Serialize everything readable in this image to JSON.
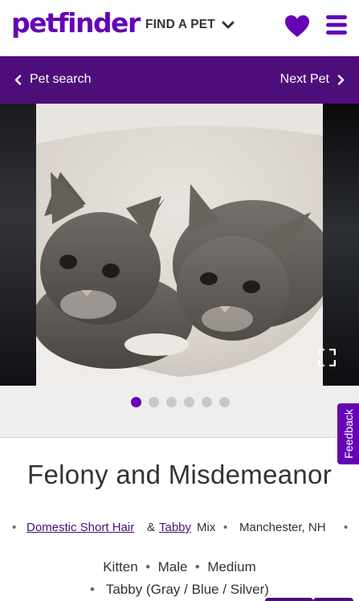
{
  "header": {
    "logo": "petfinder",
    "find_pet": "FIND A PET",
    "brand_color": "#6504b5"
  },
  "nav": {
    "prev_label": "Pet search",
    "next_label": "Next Pet",
    "bar_color": "#4d0e7a"
  },
  "carousel": {
    "photo_count": 6,
    "active_index": 0
  },
  "feedback_label": "Feedback",
  "pet": {
    "name": "Felony and Misdemeanor",
    "breed_primary": "Domestic Short Hair",
    "breed_join": "&",
    "breed_secondary": "Tabby",
    "breed_suffix": "Mix",
    "location": "Manchester, NH",
    "age": "Kitten",
    "sex": "Male",
    "size": "Medium",
    "color": "Tabby (Gray / Blue / Silver)"
  }
}
